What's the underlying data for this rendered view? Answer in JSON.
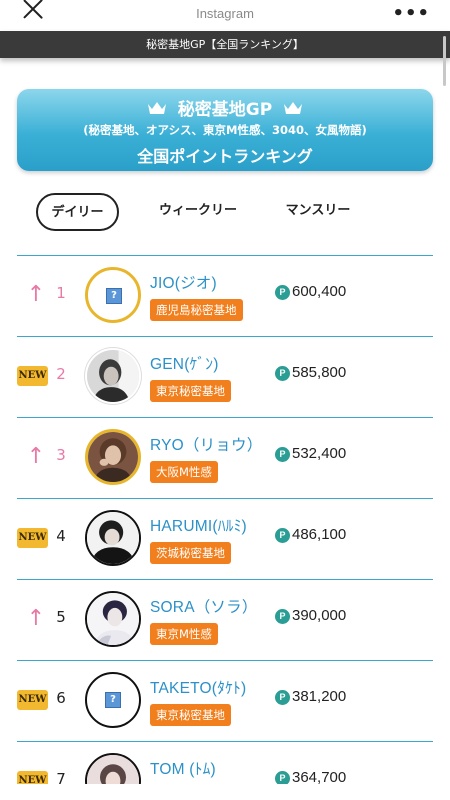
{
  "topbar": {
    "title": "Instagram",
    "close_icon": "close-icon",
    "more_icon": "more-icon",
    "more_label": "•••"
  },
  "pagebar": {
    "title": "秘密基地GP【全国ランキング】"
  },
  "card": {
    "title": "秘密基地GP",
    "subtitle": "(秘密基地、オアシス、東京M性感、3040、女風物語)",
    "heading": "全国ポイントランキング",
    "icon": "crown-icon"
  },
  "tabs": [
    {
      "label": "デイリー",
      "active": true
    },
    {
      "label": "ウィークリー",
      "active": false
    },
    {
      "label": "マンスリー",
      "active": false
    }
  ],
  "colors": {
    "accent": "#3ba7cf",
    "name": "#2b91c8",
    "shop_badge": "#f27f1d",
    "trend": "#e77aa6",
    "new_badge": "#f2b830",
    "point_icon": "#2a9d94"
  },
  "point_symbol": "P",
  "ranking": [
    {
      "rank": "1",
      "trend": "up",
      "trend_symbol": "↑",
      "name": "JIO(ジオ)",
      "shop": "鹿児島秘密基地",
      "points": "600,400",
      "avatar": "placeholder"
    },
    {
      "rank": "2",
      "trend": "new",
      "trend_symbol": "NEW",
      "name": "GEN(ｹﾞﾝ)",
      "shop": "東京秘密基地",
      "points": "585,800",
      "avatar": "photo"
    },
    {
      "rank": "3",
      "trend": "up",
      "trend_symbol": "↑",
      "name": "RYO（リョウ）",
      "shop": "大阪M性感",
      "points": "532,400",
      "avatar": "photo"
    },
    {
      "rank": "4",
      "trend": "new",
      "trend_symbol": "NEW",
      "name": "HARUMI(ﾊﾙﾐ)",
      "shop": "茨城秘密基地",
      "points": "486,100",
      "avatar": "photo"
    },
    {
      "rank": "5",
      "trend": "up",
      "trend_symbol": "↑",
      "name": "SORA（ソラ）",
      "shop": "東京M性感",
      "points": "390,000",
      "avatar": "photo"
    },
    {
      "rank": "6",
      "trend": "new",
      "trend_symbol": "NEW",
      "name": "TAKETO(ﾀｹﾄ)",
      "shop": "東京秘密基地",
      "points": "381,200",
      "avatar": "placeholder"
    },
    {
      "rank": "7",
      "trend": "new",
      "trend_symbol": "NEW",
      "name": "TOM (ﾄﾑ)",
      "shop": "",
      "points": "364,700",
      "avatar": "photo"
    }
  ]
}
